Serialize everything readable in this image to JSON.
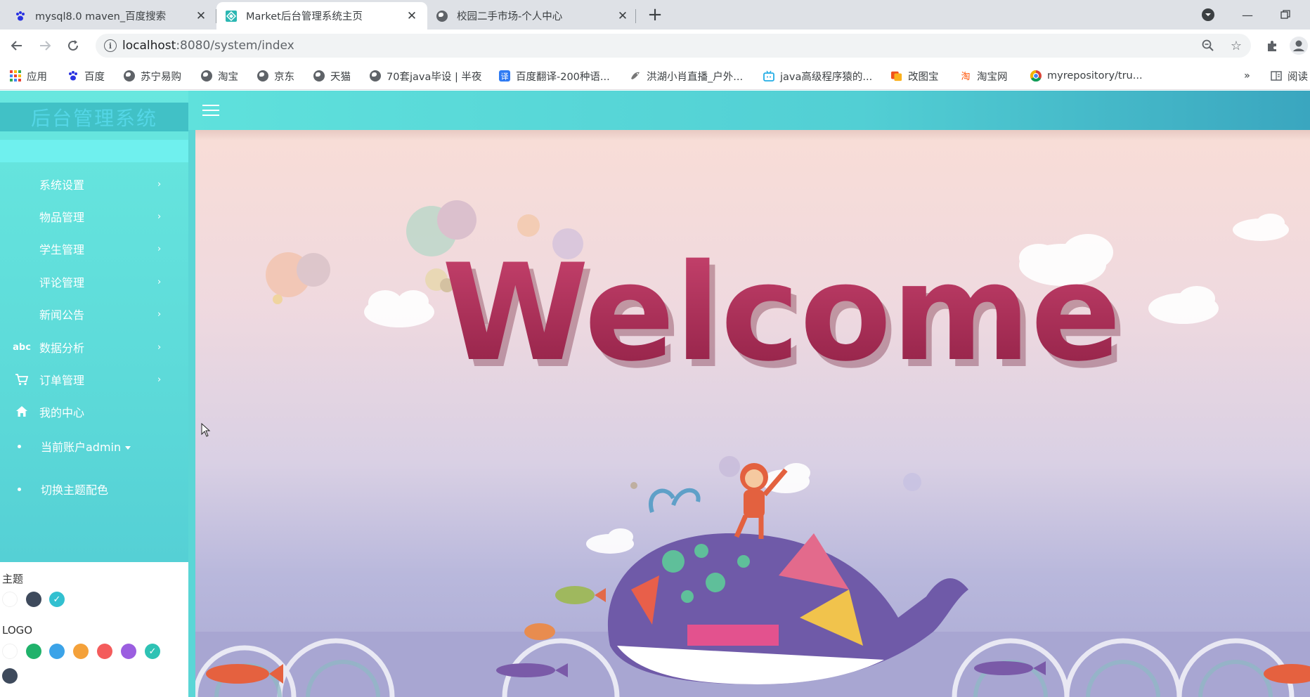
{
  "browser": {
    "tabs": [
      {
        "title": "mysql8.0 maven_百度搜索",
        "favicon": "baidu-paw-icon",
        "active": false
      },
      {
        "title": "Market后台管理系统主页",
        "favicon": "app-diamond-icon",
        "active": true
      },
      {
        "title": "校园二手市场-个人中心",
        "favicon": "globe-icon",
        "active": false
      }
    ],
    "address": {
      "host": "localhost",
      "path": ":8080/system/index"
    },
    "bookmarks": [
      {
        "label": "应用",
        "icon": "apps-grid-icon"
      },
      {
        "label": "百度",
        "icon": "baidu-paw-icon"
      },
      {
        "label": "苏宁易购",
        "icon": "globe-icon"
      },
      {
        "label": "淘宝",
        "icon": "globe-icon"
      },
      {
        "label": "京东",
        "icon": "globe-icon"
      },
      {
        "label": "天猫",
        "icon": "globe-icon"
      },
      {
        "label": "70套java毕设 | 半夜",
        "icon": "globe-icon"
      },
      {
        "label": "百度翻译-200种语...",
        "icon": "translate-icon"
      },
      {
        "label": "洪湖小肖直播_户外...",
        "icon": "bird-icon"
      },
      {
        "label": "java高级程序猿的...",
        "icon": "tv-icon"
      },
      {
        "label": "改图宝",
        "icon": "image-icon"
      },
      {
        "label": "淘宝网",
        "icon": "taobao-icon"
      },
      {
        "label": "myrepository/tru...",
        "icon": "chrome-icon"
      }
    ],
    "overflow": "»",
    "reading_list": "阅读"
  },
  "sidebar": {
    "logo": "后台管理系统",
    "menu": [
      {
        "label": "系统设置",
        "icon": "",
        "arrow": "›"
      },
      {
        "label": "物品管理",
        "icon": "",
        "arrow": "›"
      },
      {
        "label": "学生管理",
        "icon": "",
        "arrow": "›"
      },
      {
        "label": "评论管理",
        "icon": "",
        "arrow": "›"
      },
      {
        "label": "新闻公告",
        "icon": "",
        "arrow": "›"
      },
      {
        "label": "数据分析",
        "icon": "abc",
        "arrow": "›"
      },
      {
        "label": "订单管理",
        "icon": "cart-icon",
        "arrow": "›"
      },
      {
        "label": "我的中心",
        "icon": "home-icon",
        "arrow": ""
      }
    ],
    "account": "当前账户admin",
    "switch_theme": "切换主题配色",
    "theme_label": "主题",
    "logo_label": "LOGO",
    "theme_colors": [
      "#ffffff",
      "#3e4a5c",
      "#32c0d0"
    ],
    "logo_colors": [
      "#ffffff",
      "#20b26b",
      "#3ba3e8",
      "#f4a13a",
      "#f45c5c",
      "#9b5ee0",
      "#2ec2b4",
      "#3e4a5c"
    ]
  },
  "content": {
    "banner_text": "Welcome"
  }
}
